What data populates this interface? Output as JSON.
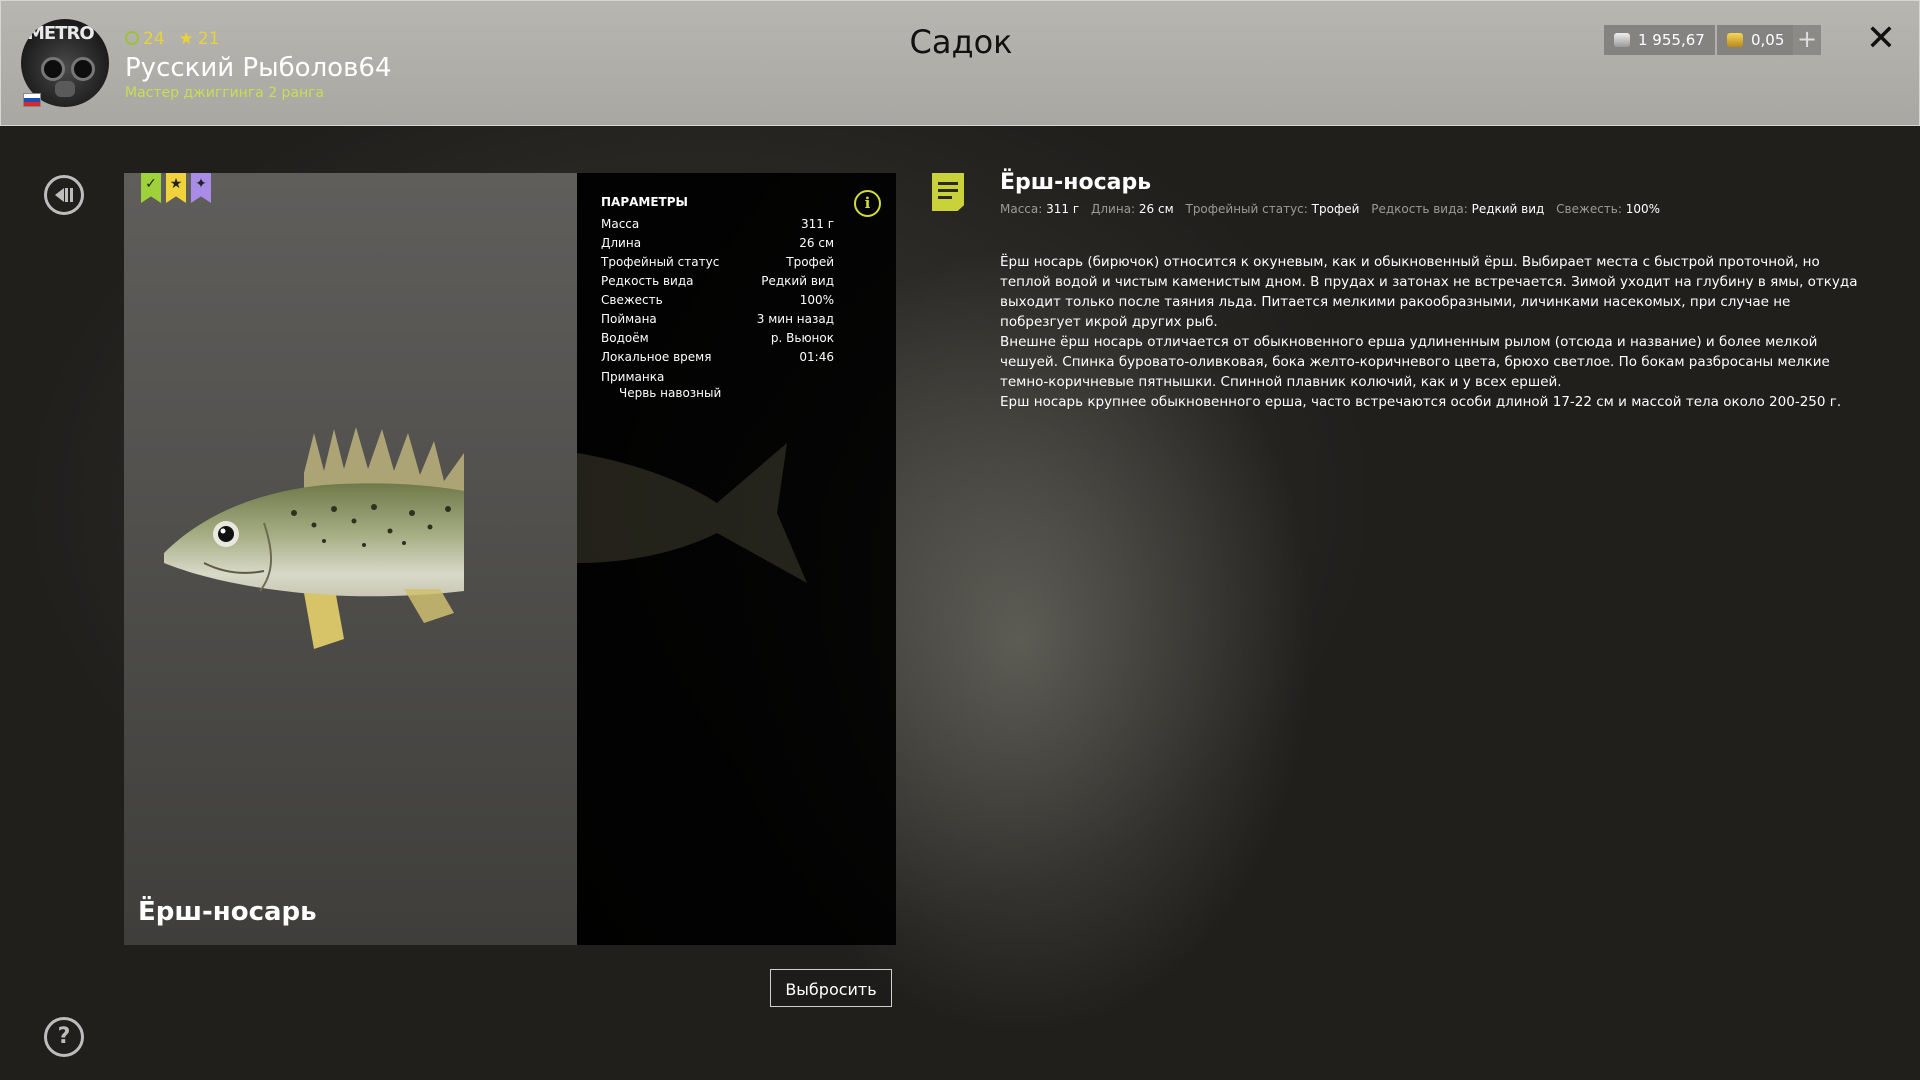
{
  "header": {
    "title": "Садок",
    "player": {
      "avatar_text": "METRO",
      "name": "Русский Рыболов64",
      "rank": "Мастер джиггинга 2 ранга",
      "level": "24",
      "stars": "21"
    },
    "currency": {
      "silver": "1 955,67",
      "gold": "0,05"
    },
    "add_label": "+",
    "close_label": "✕"
  },
  "fish": {
    "name": "Ёрш-носарь",
    "badges": [
      "✓",
      "★",
      "✦"
    ],
    "params_title": "ПАРАМЕТРЫ",
    "params": [
      {
        "label": "Масса",
        "value": "311 г"
      },
      {
        "label": "Длина",
        "value": "26 см"
      },
      {
        "label": "Трофейный статус",
        "value": "Трофей"
      },
      {
        "label": "Редкость вида",
        "value": "Редкий вид"
      },
      {
        "label": "Свежесть",
        "value": "100%"
      },
      {
        "label": "Поймана",
        "value": "3 мин назад"
      },
      {
        "label": "Водоём",
        "value": "р. Вьюнок"
      },
      {
        "label": "Локальное время",
        "value": "01:46"
      }
    ],
    "bait_label": "Приманка",
    "bait_value": "Червь навозный",
    "info_label": "i"
  },
  "actions": {
    "discard": "Выбросить",
    "help": "?"
  },
  "description": {
    "title": "Ёрш-носарь",
    "meta": [
      {
        "label": "Масса:",
        "value": "311 г"
      },
      {
        "label": "Длина:",
        "value": "26 см"
      },
      {
        "label": "Трофейный статус:",
        "value": "Трофей"
      },
      {
        "label": "Редкость вида:",
        "value": "Редкий вид"
      },
      {
        "label": "Свежесть:",
        "value": "100%"
      }
    ],
    "paragraphs": [
      "Ёрш носарь (бирючок) относится к окуневым, как и обыкновенный ёрш. Выбирает места с быстрой проточной, но теплой водой и чистым каменистым дном. В прудах и затонах не встречается. Зимой уходит на глубину в ямы, откуда выходит только после таяния льда. Питается мелкими ракообразными, личинками насекомых, при случае не побрезгует икрой других рыб.",
      "Внешне ёрш носарь отличается от обыкновенного ерша удлиненным рылом (отсюда и название) и более мелкой чешуей. Спинка буровато-оливковая, бока желто-коричневого цвета, брюхо светлое. По бокам разбросаны мелкие темно-коричневые пятнышки. Спинной плавник колючий, как и у всех ершей.",
      "Ерш носарь крупнее обыкновенного ерша, часто встречаются особи длиной 17-22 см и массой тела около 200-250 г."
    ]
  },
  "colors": {
    "accent_yellow": "#e6d33a",
    "rank_green": "#c8de50",
    "info_yellow": "#d3da3c"
  }
}
